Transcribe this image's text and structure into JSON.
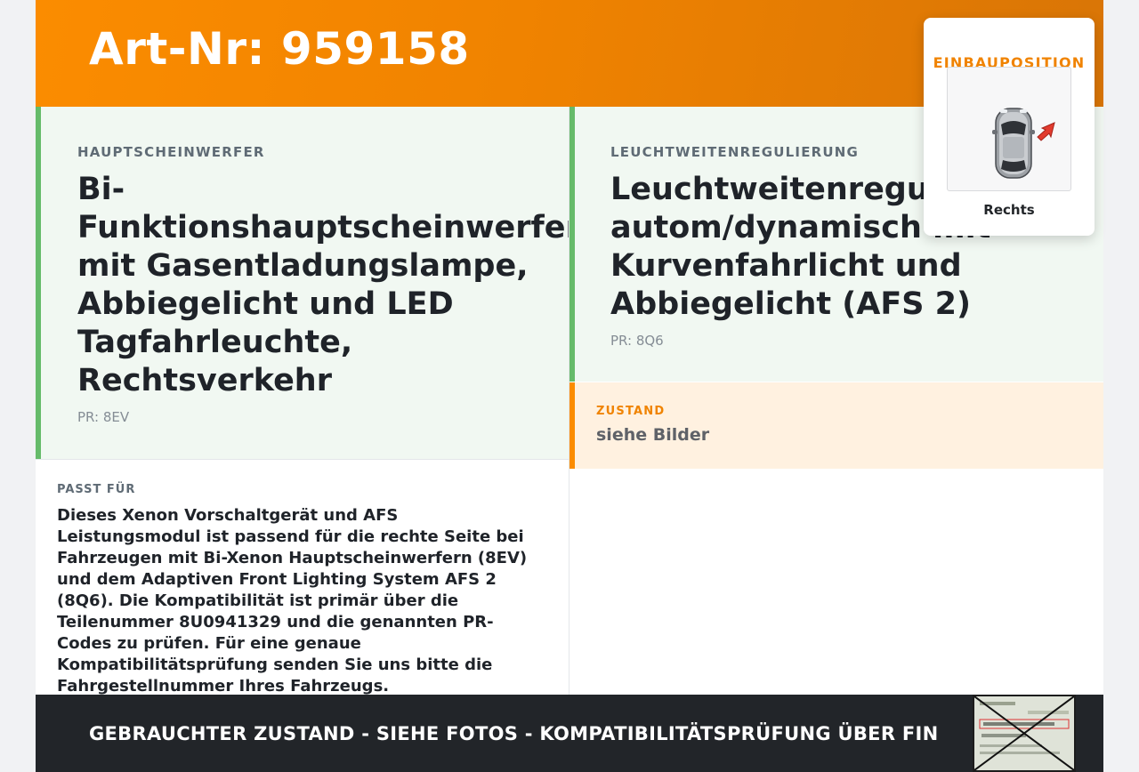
{
  "header": {
    "art_nr": "Art-Nr: 959158"
  },
  "main_part": {
    "category": "HAUPTSCHEINWERFER",
    "title": "Bi-Funktionshauptscheinwerfer mit Gasentladungslampe, Abbiegelicht und LED Tagfahrleuchte, Rechtsverkehr",
    "pr_code": "PR: 8EV"
  },
  "second_part": {
    "category": "LEUCHTWEITENREGULIERUNG",
    "title": "Leuchtweitenregulierung autom/dynamisch mit Kurvenfahrlicht und Abbiegelicht (AFS 2)",
    "pr_code": "PR: 8Q6"
  },
  "condition": {
    "label": "ZUSTAND",
    "value": "siehe Bilder"
  },
  "fits": {
    "label": "PASST FÜR",
    "text": "Dieses Xenon Vorschaltgerät und AFS Leistungsmodul ist passend für die rechte Seite bei Fahrzeugen mit Bi-Xenon Hauptscheinwerfern (8EV) und dem Adaptiven Front Lighting System AFS 2 (8Q6). Die Kompatibilität ist primär über die Teilenummer 8U0941329 und die genannten PR-Codes zu prüfen. Für eine genaue Kompatibilitätsprüfung senden Sie uns bitte die Fahrgestellnummer Ihres Fahrzeugs."
  },
  "footer": {
    "text": "GEBRAUCHTER ZUSTAND - SIEHE FOTOS - KOMPATIBILITÄTSPRÜFUNG ÜBER FIN"
  },
  "install_position": {
    "title": "EINBAUPOSITION",
    "caption": "Rechts",
    "icon": "car-top-view-icon"
  },
  "colors": {
    "accent_orange": "#fb8c00",
    "accent_green": "#66bb6a",
    "footer_bg": "#222529"
  }
}
